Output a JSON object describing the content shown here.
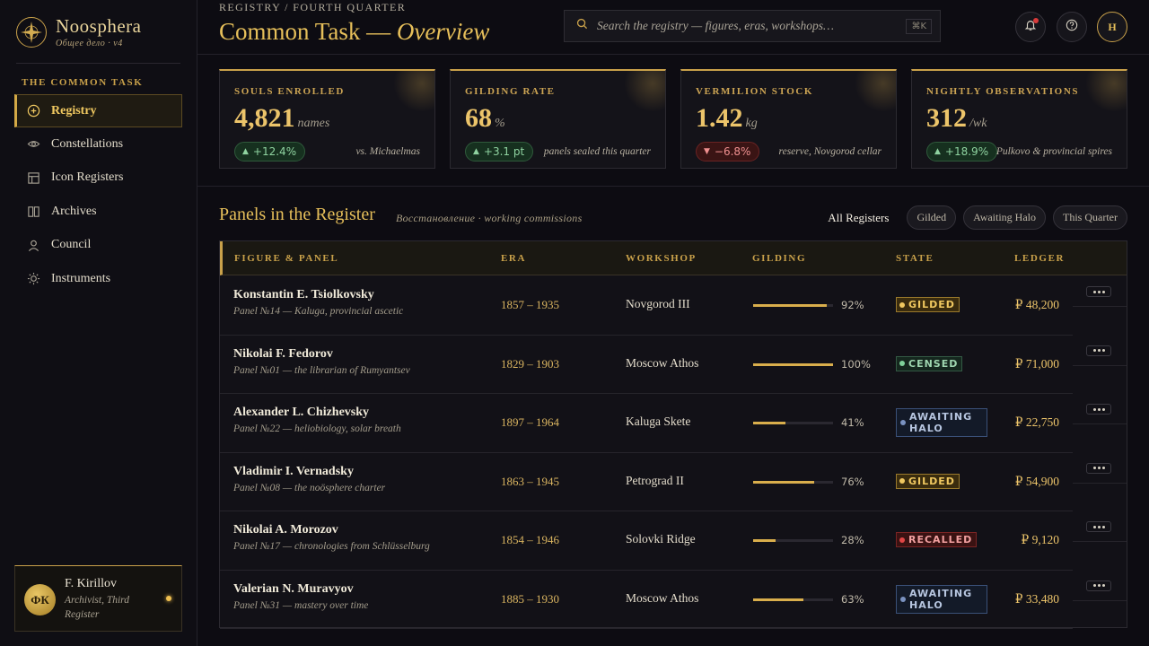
{
  "brand": {
    "title": "Noosphera",
    "subtitle": "Общее дело · v4"
  },
  "sidebar": {
    "section": "THE COMMON TASK",
    "items": [
      {
        "label": "Registry",
        "icon": "plus-circle-icon"
      },
      {
        "label": "Constellations",
        "icon": "eye-icon"
      },
      {
        "label": "Icon Registers",
        "icon": "grid-icon"
      },
      {
        "label": "Archives",
        "icon": "book-icon"
      },
      {
        "label": "Council",
        "icon": "person-icon"
      },
      {
        "label": "Instruments",
        "icon": "sun-icon"
      }
    ],
    "user": {
      "initials": "ФК",
      "name": "F. Kirillov",
      "role": "Archivist, Third Register"
    }
  },
  "header": {
    "breadcrumb": "REGISTRY / FOURTH QUARTER",
    "title": "Common Task — ",
    "title_italic": "Overview",
    "search_placeholder": "Search the registry — figures, eras, workshops…",
    "search_shortcut": "⌘K",
    "user_initial": "H"
  },
  "kpis": [
    {
      "label": "SOULS ENROLLED",
      "value": "4,821",
      "unit": "names",
      "delta": "+12.4%",
      "direction": "up",
      "note": "vs. Michaelmas"
    },
    {
      "label": "GILDING RATE",
      "value": "68",
      "unit": "%",
      "delta": "+3.1 pt",
      "direction": "up",
      "note": "panels sealed this quarter"
    },
    {
      "label": "VERMILION STOCK",
      "value": "1.42",
      "unit": "kg",
      "delta": "−6.8%",
      "direction": "down",
      "note": "reserve, Novgorod cellar"
    },
    {
      "label": "NIGHTLY OBSERVATIONS",
      "value": "312",
      "unit": "/wk",
      "delta": "+18.9%",
      "direction": "up",
      "note": "Pulkovo & provincial spires"
    }
  ],
  "section": {
    "title": "Panels in the Register",
    "subtitle": "Восстановление · working commissions",
    "filters": {
      "all": "All Registers",
      "chips": [
        "Gilded",
        "Awaiting Halo",
        "This Quarter"
      ]
    }
  },
  "table": {
    "columns": [
      "FIGURE & PANEL",
      "ERA",
      "WORKSHOP",
      "GILDING",
      "STATE",
      "LEDGER"
    ],
    "rows": [
      {
        "name": "Konstantin E. Tsiolkovsky",
        "panel": "Panel №14 — Kaluga, provincial ascetic",
        "era": "1857 – 1935",
        "workshop": "Novgorod III",
        "gilding": 92,
        "gilding_label": "92%",
        "state": "GILDED",
        "state_kind": "gilded",
        "ledger": "₽ 48,200"
      },
      {
        "name": "Nikolai F. Fedorov",
        "panel": "Panel №01 — the librarian of Rumyantsev",
        "era": "1829 – 1903",
        "workshop": "Moscow Athos",
        "gilding": 100,
        "gilding_label": "100%",
        "state": "CENSED",
        "state_kind": "censed",
        "ledger": "₽ 71,000"
      },
      {
        "name": "Alexander L. Chizhevsky",
        "panel": "Panel №22 — heliobiology, solar breath",
        "era": "1897 – 1964",
        "workshop": "Kaluga Skete",
        "gilding": 41,
        "gilding_label": "41%",
        "state": "AWAITING HALO",
        "state_kind": "awaiting",
        "ledger": "₽ 22,750"
      },
      {
        "name": "Vladimir I. Vernadsky",
        "panel": "Panel №08 — the noösphere charter",
        "era": "1863 – 1945",
        "workshop": "Petrograd II",
        "gilding": 76,
        "gilding_label": "76%",
        "state": "GILDED",
        "state_kind": "gilded",
        "ledger": "₽ 54,900"
      },
      {
        "name": "Nikolai A. Morozov",
        "panel": "Panel №17 — chronologies from Schlüsselburg",
        "era": "1854 – 1946",
        "workshop": "Solovki Ridge",
        "gilding": 28,
        "gilding_label": "28%",
        "state": "RECALLED",
        "state_kind": "recalled",
        "ledger": "₽ 9,120"
      },
      {
        "name": "Valerian N. Muravyov",
        "panel": "Panel №31 — mastery over time",
        "era": "1885 – 1930",
        "workshop": "Moscow Athos",
        "gilding": 63,
        "gilding_label": "63%",
        "state": "AWAITING HALO",
        "state_kind": "awaiting",
        "ledger": "₽ 33,480"
      }
    ]
  },
  "colors": {
    "accent": "#c9a14a",
    "gold": "#e6bf5a",
    "background": "#0d0c12",
    "positive": "#8fd3a0",
    "negative": "#f09090"
  }
}
